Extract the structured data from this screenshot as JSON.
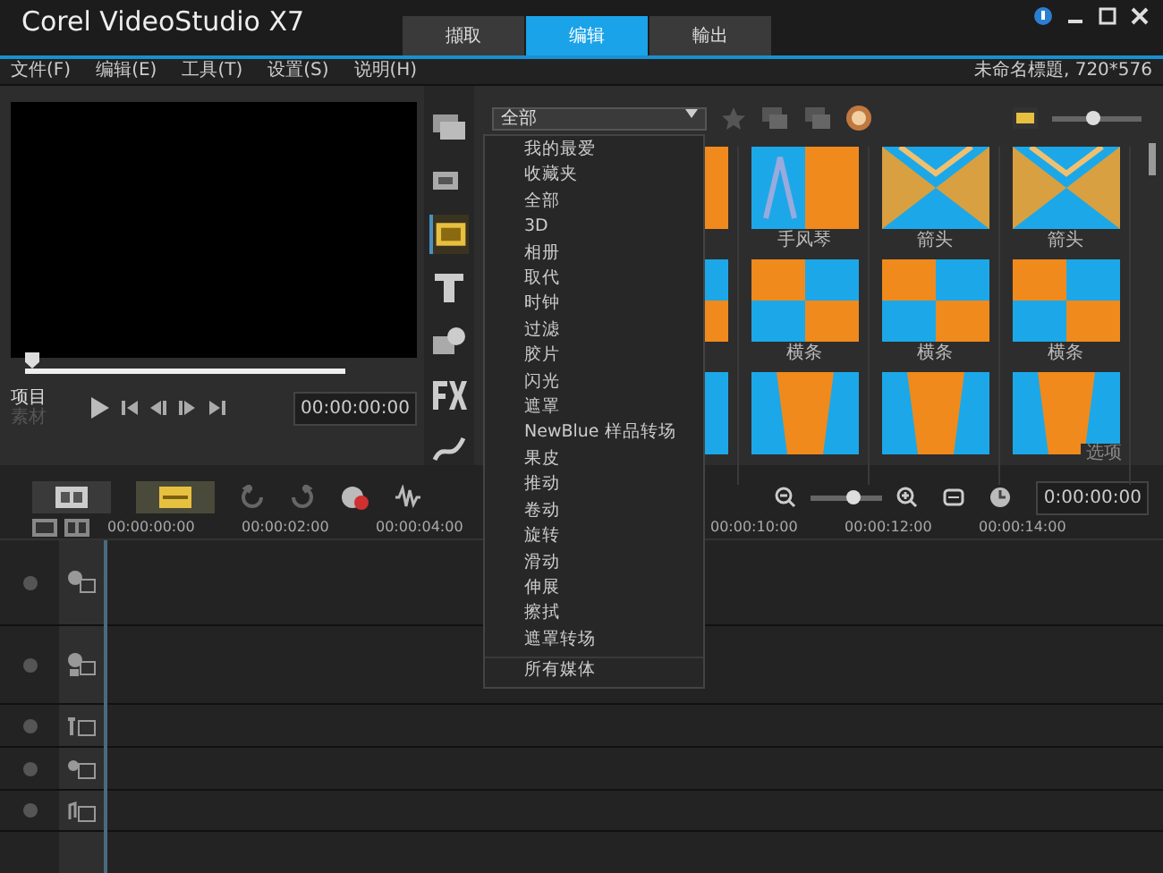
{
  "window": {
    "title": "Corel VideoStudio X7"
  },
  "mode_tabs": [
    {
      "label": "擷取",
      "selected": false
    },
    {
      "label": "编辑",
      "selected": true
    },
    {
      "label": "輸出",
      "selected": false
    }
  ],
  "menu": [
    "文件(F)",
    "编辑(E)",
    "工具(T)",
    "设置(S)",
    "说明(H)"
  ],
  "project_info": "未命名標題, 720*576",
  "player": {
    "modes": [
      {
        "label": "项目",
        "selected": true
      },
      {
        "label": "素材",
        "selected": false
      }
    ],
    "level": 0,
    "timecode": "00:00:00:00"
  },
  "side_tools": [
    {
      "kind": "media",
      "selected": false
    },
    {
      "kind": "instant",
      "selected": false
    },
    {
      "kind": "transition",
      "selected": true
    },
    {
      "kind": "title",
      "selected": false
    },
    {
      "kind": "graphic",
      "selected": false
    },
    {
      "kind": "filter",
      "selected": false
    },
    {
      "kind": "path",
      "selected": false
    }
  ],
  "library": {
    "category": "全部",
    "zoom": {
      "level": 0.45
    },
    "thumbnails": [
      {
        "kind": "picture"
      },
      {
        "kind": "picture",
        "caption": "手风琴"
      },
      {
        "kind": "picture",
        "caption": "箭头"
      },
      {
        "kind": "picture",
        "caption": "箭头"
      },
      {
        "kind": "picture"
      },
      {
        "kind": "picture",
        "caption": "横条"
      },
      {
        "kind": "picture",
        "caption": "横条"
      },
      {
        "kind": "picture",
        "caption": "横条"
      },
      {
        "kind": "picture"
      },
      {
        "kind": "picture"
      },
      {
        "kind": "picture"
      },
      {
        "kind": "picture"
      }
    ],
    "options": "选项"
  },
  "category_menu": {
    "items": [
      "我的最爱",
      "收藏夹",
      "全部",
      "3D",
      "相册",
      "取代",
      "时钟",
      "过滤",
      "胶片",
      "闪光",
      "遮罩",
      "NewBlue 样品转场",
      "果皮",
      "推动",
      "卷动",
      "旋转",
      "滑动",
      "伸展",
      "擦拭",
      "遮罩转场"
    ],
    "footer": "所有媒体"
  },
  "timeline": {
    "view_buttons": [
      {
        "kind": "storyboard",
        "selected": false
      },
      {
        "kind": "timeline",
        "selected": true
      }
    ],
    "zoom": {
      "level": 0.6
    },
    "timecode": "0:00:00:00",
    "ruler": [
      "00:00:00:00",
      "00:00:02:00",
      "00:00:04:00",
      "00:00:10:00",
      "00:00:12:00",
      "00:00:14:00"
    ],
    "tracks": [
      {
        "kind": "video"
      },
      {
        "kind": "overlay"
      },
      {
        "kind": "title"
      },
      {
        "kind": "voice"
      },
      {
        "kind": "music"
      }
    ]
  }
}
